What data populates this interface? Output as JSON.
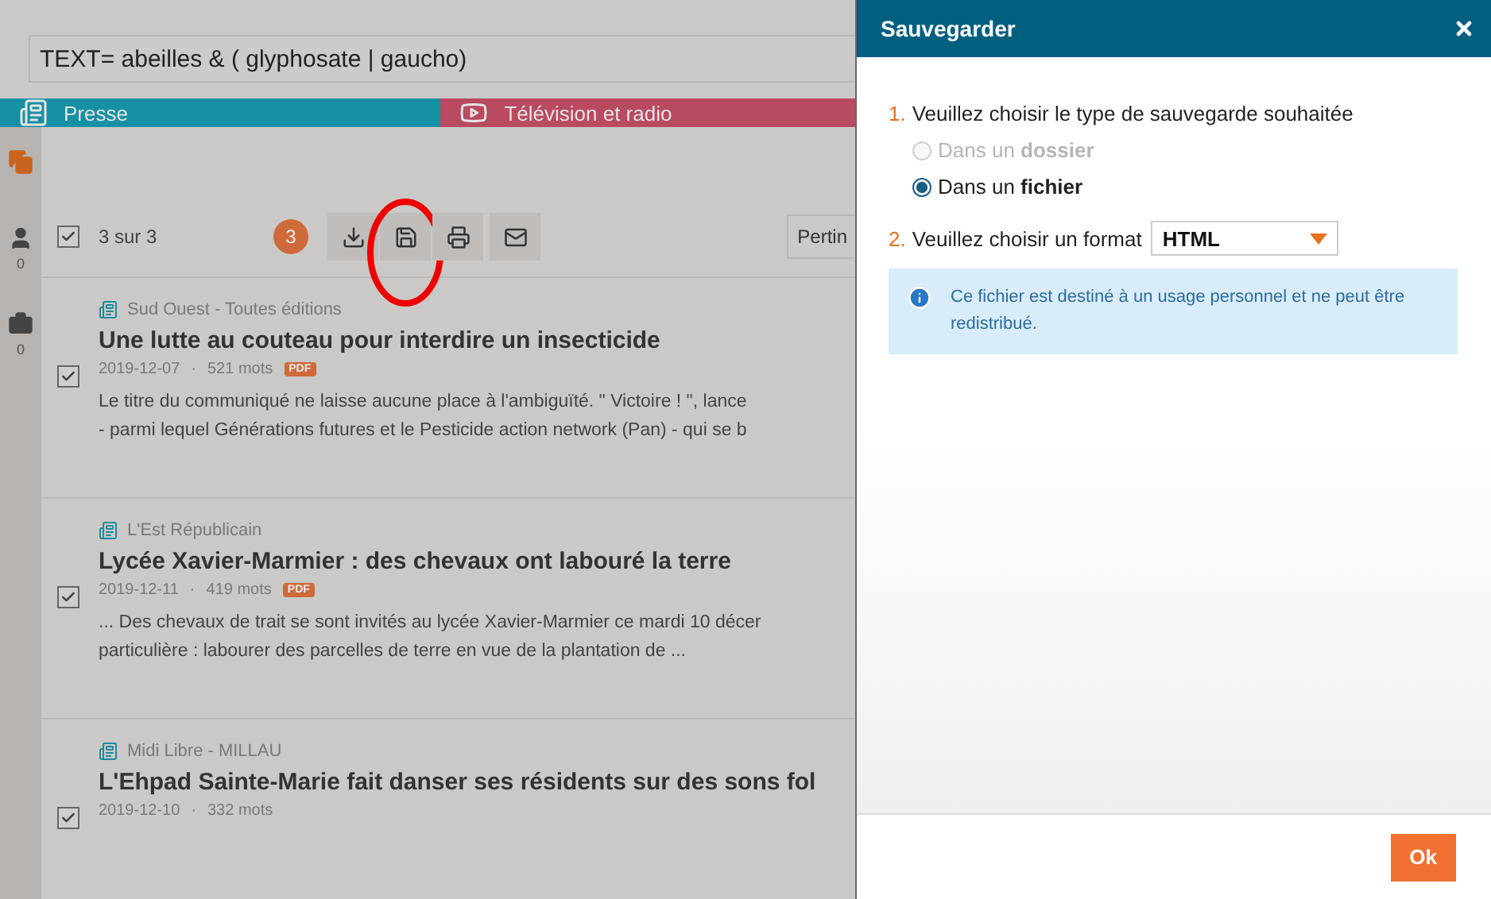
{
  "search": {
    "value": "TEXT= abeilles & ( glyphosate | gaucho)"
  },
  "tabs": [
    {
      "label": "Presse",
      "kind": "press",
      "color": "#1690a4"
    },
    {
      "label": "Télévision et radio",
      "kind": "tv",
      "color": "#b84a62"
    }
  ],
  "sidebar": [
    {
      "kind": "copies",
      "active": true
    },
    {
      "kind": "person",
      "active": false,
      "count": "0"
    },
    {
      "kind": "briefcase",
      "active": false,
      "count": "0"
    }
  ],
  "toolbar": {
    "all_checked": true,
    "count_label": "3 sur 3",
    "badge": "3",
    "actions": [
      {
        "kind": "download",
        "highlighted": false
      },
      {
        "kind": "save",
        "highlighted": true
      },
      {
        "kind": "print",
        "highlighted": false
      },
      {
        "kind": "mail",
        "highlighted": false
      }
    ],
    "sort": "Pertin"
  },
  "articles": [
    {
      "source": "Sud Ouest - Toutes éditions",
      "title": "Une lutte au couteau pour interdire un insecticide",
      "checked": true,
      "date": "2019-12-07",
      "separator": "·",
      "words": "521 mots",
      "pdf": "PDF",
      "snippet": [
        "Le titre du communiqué ne laisse aucune place à l'ambiguïté. \" Victoire ! \", lance",
        "- parmi lequel Générations futures et le Pesticide action network (Pan) - qui se b"
      ]
    },
    {
      "source": "L'Est Républicain",
      "title": "Lycée Xavier-Marmier : des chevaux ont labouré la terre",
      "checked": true,
      "date": "2019-12-11",
      "separator": "·",
      "words": "419 mots",
      "pdf": "PDF",
      "snippet": [
        "... Des chevaux de trait se sont invités au lycée Xavier-Marmier ce mardi 10 décer",
        "particulière : labourer des parcelles de terre en vue de la plantation de ..."
      ]
    },
    {
      "source": "Midi Libre - MILLAU",
      "title": "L'Ehpad Sainte-Marie fait danser ses résidents sur des sons fol",
      "checked": true,
      "date": "2019-12-10",
      "separator": "·",
      "words": "332 mots"
    }
  ],
  "dialog": {
    "title": "Sauvegarder",
    "step1": {
      "number": "1.",
      "label": "Veuillez choisir le type de sauvegarde souhaitée"
    },
    "options": [
      {
        "label": "Dans un **dossier**",
        "selected": false,
        "disabled": true
      },
      {
        "label": "Dans un **fichier**",
        "selected": true,
        "disabled": false
      }
    ],
    "step2": {
      "number": "2.",
      "label": "Veuillez choisir un format",
      "format": "HTML"
    },
    "info": "Ce fichier est destiné à un usage personnel et ne peut être redistribué.",
    "ok": "Ok"
  }
}
